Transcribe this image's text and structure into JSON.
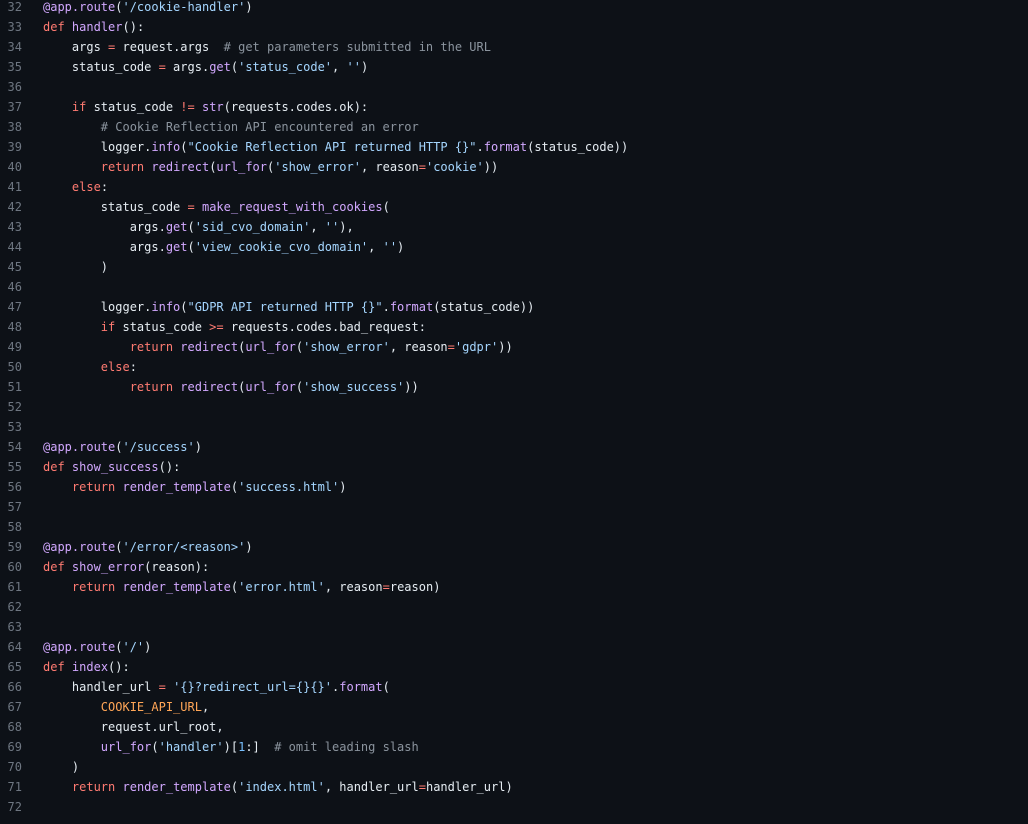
{
  "editor": {
    "theme_colors": {
      "background": "#0d1117",
      "text": "#e6edf3",
      "line_number": "#6e7681",
      "keyword": "#ff7b72",
      "function": "#d2a8ff",
      "string": "#a5d6ff",
      "comment": "#8b949e",
      "number": "#79c0ff",
      "constant": "#ffa657"
    },
    "lines": [
      {
        "n": "32",
        "tokens": [
          [
            "fn",
            "@app.route"
          ],
          [
            "d",
            "("
          ],
          [
            "str",
            "'/cookie-handler'"
          ],
          [
            "d",
            ")"
          ]
        ]
      },
      {
        "n": "33",
        "tokens": [
          [
            "kw",
            "def"
          ],
          [
            "d",
            " "
          ],
          [
            "fn",
            "handler"
          ],
          [
            "d",
            "():"
          ]
        ]
      },
      {
        "n": "34",
        "tokens": [
          [
            "d",
            "    args "
          ],
          [
            "op",
            "="
          ],
          [
            "d",
            " request.args  "
          ],
          [
            "com",
            "# get parameters submitted in the URL"
          ]
        ]
      },
      {
        "n": "35",
        "tokens": [
          [
            "d",
            "    status_code "
          ],
          [
            "op",
            "="
          ],
          [
            "d",
            " args."
          ],
          [
            "fn",
            "get"
          ],
          [
            "d",
            "("
          ],
          [
            "str",
            "'status_code'"
          ],
          [
            "d",
            ", "
          ],
          [
            "str",
            "''"
          ],
          [
            "d",
            ")"
          ]
        ]
      },
      {
        "n": "36",
        "tokens": []
      },
      {
        "n": "37",
        "tokens": [
          [
            "d",
            "    "
          ],
          [
            "kw",
            "if"
          ],
          [
            "d",
            " status_code "
          ],
          [
            "op",
            "!="
          ],
          [
            "d",
            " "
          ],
          [
            "fn",
            "str"
          ],
          [
            "d",
            "(requests.codes.ok):"
          ]
        ]
      },
      {
        "n": "38",
        "tokens": [
          [
            "d",
            "        "
          ],
          [
            "com",
            "# Cookie Reflection API encountered an error"
          ]
        ]
      },
      {
        "n": "39",
        "tokens": [
          [
            "d",
            "        logger."
          ],
          [
            "fn",
            "info"
          ],
          [
            "d",
            "("
          ],
          [
            "str",
            "\"Cookie Reflection API returned HTTP {}\""
          ],
          [
            "d",
            "."
          ],
          [
            "fn",
            "format"
          ],
          [
            "d",
            "(status_code))"
          ]
        ]
      },
      {
        "n": "40",
        "tokens": [
          [
            "d",
            "        "
          ],
          [
            "kw",
            "return"
          ],
          [
            "d",
            " "
          ],
          [
            "fn",
            "redirect"
          ],
          [
            "d",
            "("
          ],
          [
            "fn",
            "url_for"
          ],
          [
            "d",
            "("
          ],
          [
            "str",
            "'show_error'"
          ],
          [
            "d",
            ", reason"
          ],
          [
            "op",
            "="
          ],
          [
            "str",
            "'cookie'"
          ],
          [
            "d",
            "))"
          ]
        ]
      },
      {
        "n": "41",
        "tokens": [
          [
            "d",
            "    "
          ],
          [
            "kw",
            "else"
          ],
          [
            "d",
            ":"
          ]
        ]
      },
      {
        "n": "42",
        "tokens": [
          [
            "d",
            "        status_code "
          ],
          [
            "op",
            "="
          ],
          [
            "d",
            " "
          ],
          [
            "fn",
            "make_request_with_cookies"
          ],
          [
            "d",
            "("
          ]
        ]
      },
      {
        "n": "43",
        "tokens": [
          [
            "d",
            "            args."
          ],
          [
            "fn",
            "get"
          ],
          [
            "d",
            "("
          ],
          [
            "str",
            "'sid_cvo_domain'"
          ],
          [
            "d",
            ", "
          ],
          [
            "str",
            "''"
          ],
          [
            "d",
            "),"
          ]
        ]
      },
      {
        "n": "44",
        "tokens": [
          [
            "d",
            "            args."
          ],
          [
            "fn",
            "get"
          ],
          [
            "d",
            "("
          ],
          [
            "str",
            "'view_cookie_cvo_domain'"
          ],
          [
            "d",
            ", "
          ],
          [
            "str",
            "''"
          ],
          [
            "d",
            ")"
          ]
        ]
      },
      {
        "n": "45",
        "tokens": [
          [
            "d",
            "        )"
          ]
        ]
      },
      {
        "n": "46",
        "tokens": []
      },
      {
        "n": "47",
        "tokens": [
          [
            "d",
            "        logger."
          ],
          [
            "fn",
            "info"
          ],
          [
            "d",
            "("
          ],
          [
            "str",
            "\"GDPR API returned HTTP {}\""
          ],
          [
            "d",
            "."
          ],
          [
            "fn",
            "format"
          ],
          [
            "d",
            "(status_code))"
          ]
        ]
      },
      {
        "n": "48",
        "tokens": [
          [
            "d",
            "        "
          ],
          [
            "kw",
            "if"
          ],
          [
            "d",
            " status_code "
          ],
          [
            "op",
            ">="
          ],
          [
            "d",
            " requests.codes.bad_request:"
          ]
        ]
      },
      {
        "n": "49",
        "tokens": [
          [
            "d",
            "            "
          ],
          [
            "kw",
            "return"
          ],
          [
            "d",
            " "
          ],
          [
            "fn",
            "redirect"
          ],
          [
            "d",
            "("
          ],
          [
            "fn",
            "url_for"
          ],
          [
            "d",
            "("
          ],
          [
            "str",
            "'show_error'"
          ],
          [
            "d",
            ", reason"
          ],
          [
            "op",
            "="
          ],
          [
            "str",
            "'gdpr'"
          ],
          [
            "d",
            "))"
          ]
        ]
      },
      {
        "n": "50",
        "tokens": [
          [
            "d",
            "        "
          ],
          [
            "kw",
            "else"
          ],
          [
            "d",
            ":"
          ]
        ]
      },
      {
        "n": "51",
        "tokens": [
          [
            "d",
            "            "
          ],
          [
            "kw",
            "return"
          ],
          [
            "d",
            " "
          ],
          [
            "fn",
            "redirect"
          ],
          [
            "d",
            "("
          ],
          [
            "fn",
            "url_for"
          ],
          [
            "d",
            "("
          ],
          [
            "str",
            "'show_success'"
          ],
          [
            "d",
            "))"
          ]
        ]
      },
      {
        "n": "52",
        "tokens": []
      },
      {
        "n": "53",
        "tokens": []
      },
      {
        "n": "54",
        "tokens": [
          [
            "fn",
            "@app.route"
          ],
          [
            "d",
            "("
          ],
          [
            "str",
            "'/success'"
          ],
          [
            "d",
            ")"
          ]
        ]
      },
      {
        "n": "55",
        "tokens": [
          [
            "kw",
            "def"
          ],
          [
            "d",
            " "
          ],
          [
            "fn",
            "show_success"
          ],
          [
            "d",
            "():"
          ]
        ]
      },
      {
        "n": "56",
        "tokens": [
          [
            "d",
            "    "
          ],
          [
            "kw",
            "return"
          ],
          [
            "d",
            " "
          ],
          [
            "fn",
            "render_template"
          ],
          [
            "d",
            "("
          ],
          [
            "str",
            "'success.html'"
          ],
          [
            "d",
            ")"
          ]
        ]
      },
      {
        "n": "57",
        "tokens": []
      },
      {
        "n": "58",
        "tokens": []
      },
      {
        "n": "59",
        "tokens": [
          [
            "fn",
            "@app.route"
          ],
          [
            "d",
            "("
          ],
          [
            "str",
            "'/error/<reason>'"
          ],
          [
            "d",
            ")"
          ]
        ]
      },
      {
        "n": "60",
        "tokens": [
          [
            "kw",
            "def"
          ],
          [
            "d",
            " "
          ],
          [
            "fn",
            "show_error"
          ],
          [
            "d",
            "(reason):"
          ]
        ]
      },
      {
        "n": "61",
        "tokens": [
          [
            "d",
            "    "
          ],
          [
            "kw",
            "return"
          ],
          [
            "d",
            " "
          ],
          [
            "fn",
            "render_template"
          ],
          [
            "d",
            "("
          ],
          [
            "str",
            "'error.html'"
          ],
          [
            "d",
            ", reason"
          ],
          [
            "op",
            "="
          ],
          [
            "d",
            "reason)"
          ]
        ]
      },
      {
        "n": "62",
        "tokens": []
      },
      {
        "n": "63",
        "tokens": []
      },
      {
        "n": "64",
        "tokens": [
          [
            "fn",
            "@app.route"
          ],
          [
            "d",
            "("
          ],
          [
            "str",
            "'/'"
          ],
          [
            "d",
            ")"
          ]
        ]
      },
      {
        "n": "65",
        "tokens": [
          [
            "kw",
            "def"
          ],
          [
            "d",
            " "
          ],
          [
            "fn",
            "index"
          ],
          [
            "d",
            "():"
          ]
        ]
      },
      {
        "n": "66",
        "tokens": [
          [
            "d",
            "    handler_url "
          ],
          [
            "op",
            "="
          ],
          [
            "d",
            " "
          ],
          [
            "str",
            "'{}?redirect_url={}{}'"
          ],
          [
            "d",
            "."
          ],
          [
            "fn",
            "format"
          ],
          [
            "d",
            "("
          ]
        ]
      },
      {
        "n": "67",
        "tokens": [
          [
            "d",
            "        "
          ],
          [
            "const",
            "COOKIE_API_URL"
          ],
          [
            "d",
            ","
          ]
        ]
      },
      {
        "n": "68",
        "tokens": [
          [
            "d",
            "        request.url_root,"
          ]
        ]
      },
      {
        "n": "69",
        "tokens": [
          [
            "d",
            "        "
          ],
          [
            "fn",
            "url_for"
          ],
          [
            "d",
            "("
          ],
          [
            "str",
            "'handler'"
          ],
          [
            "d",
            ")["
          ],
          [
            "num",
            "1"
          ],
          [
            "d",
            ":]  "
          ],
          [
            "com",
            "# omit leading slash"
          ]
        ]
      },
      {
        "n": "70",
        "tokens": [
          [
            "d",
            "    )"
          ]
        ]
      },
      {
        "n": "71",
        "tokens": [
          [
            "d",
            "    "
          ],
          [
            "kw",
            "return"
          ],
          [
            "d",
            " "
          ],
          [
            "fn",
            "render_template"
          ],
          [
            "d",
            "("
          ],
          [
            "str",
            "'index.html'"
          ],
          [
            "d",
            ", handler_url"
          ],
          [
            "op",
            "="
          ],
          [
            "d",
            "handler_url)"
          ]
        ]
      },
      {
        "n": "72",
        "tokens": []
      }
    ]
  }
}
